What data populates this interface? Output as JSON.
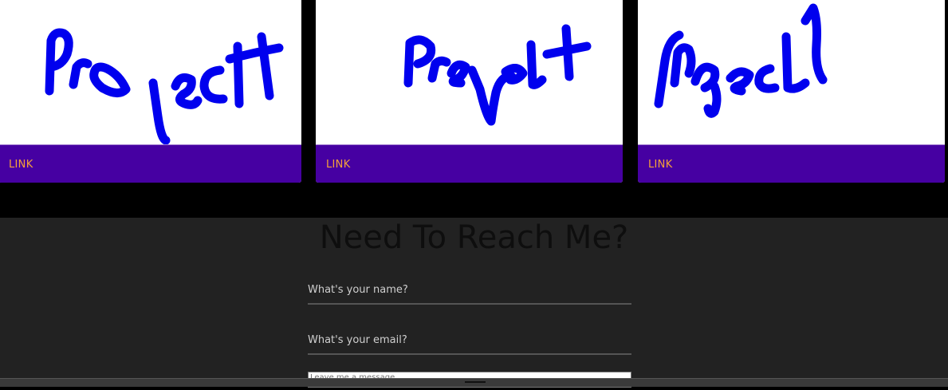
{
  "projects": {
    "cards": [
      {
        "link_label": "LINK",
        "thumbnail": "handwritten-project-1"
      },
      {
        "link_label": "LINK",
        "thumbnail": "handwritten-project-2"
      },
      {
        "link_label": "LINK",
        "thumbnail": "handwritten-project-3"
      }
    ],
    "colors": {
      "card_bar": "#4600a2",
      "link": "#f4a23a",
      "ink": "#0000ee"
    }
  },
  "contact": {
    "title": "Need To Reach Me?",
    "name_placeholder": "What's your name?",
    "email_placeholder": "What's your email?",
    "message_placeholder": "Leave me a message"
  }
}
